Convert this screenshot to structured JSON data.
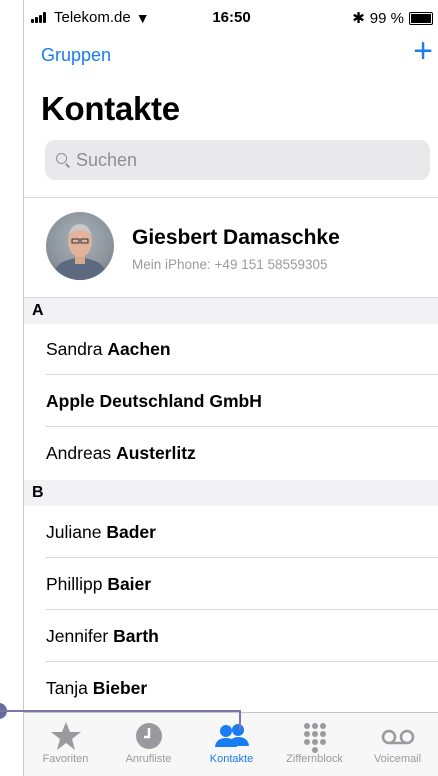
{
  "status_bar": {
    "carrier": "Telekom.de",
    "time": "16:50",
    "battery": "99 %"
  },
  "nav": {
    "back_label": "Gruppen",
    "add_label": "+"
  },
  "title": "Kontakte",
  "search": {
    "placeholder": "Suchen"
  },
  "my_card": {
    "name": "Giesbert Damaschke",
    "subtitle": "Mein iPhone: +49 151 58559305"
  },
  "sections": [
    {
      "letter": "A",
      "contacts": [
        {
          "first": "Sandra",
          "last": "Aachen"
        },
        {
          "first": "",
          "last": "Apple Deutschland GmbH"
        },
        {
          "first": "Andreas",
          "last": "Austerlitz"
        }
      ]
    },
    {
      "letter": "B",
      "contacts": [
        {
          "first": "Juliane",
          "last": "Bader"
        },
        {
          "first": "Phillipp",
          "last": "Baier"
        },
        {
          "first": "Jennifer",
          "last": "Barth"
        },
        {
          "first": "Tanja",
          "last": "Bieber"
        }
      ]
    }
  ],
  "tabbar": {
    "tabs": [
      {
        "label": "Favoriten",
        "icon": "star-icon"
      },
      {
        "label": "Anrufliste",
        "icon": "clock-icon"
      },
      {
        "label": "Kontakte",
        "icon": "contacts-icon",
        "active": true
      },
      {
        "label": "Ziffernblock",
        "icon": "keypad-icon"
      },
      {
        "label": "Voicemail",
        "icon": "voicemail-icon"
      }
    ]
  },
  "colors": {
    "accent": "#1a7cf1",
    "callout": "#7a78a8",
    "inactive_tab": "#9a9a9e"
  }
}
